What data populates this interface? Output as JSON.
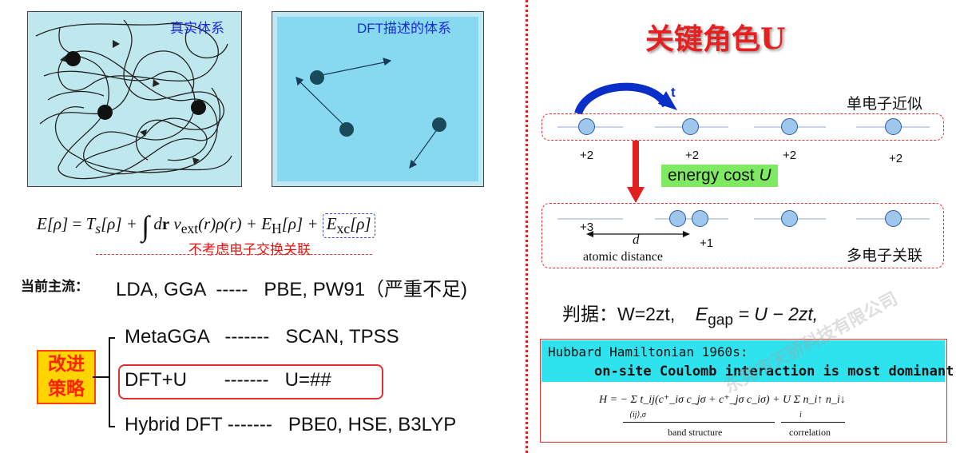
{
  "left": {
    "panel_real_label": "真实体系",
    "panel_dft_label": "DFT描述的体系",
    "formula": {
      "lhs": "E[ρ]",
      "eq": " = ",
      "ts": "T",
      "ts_sub": "s",
      "ts_arg": "[ρ] + ",
      "integral": "∫",
      "dr": " d",
      "dr_bold": "r",
      "v": " v",
      "v_sub": "ext",
      "v_arg": "(r)ρ(r) + ",
      "eh": "E",
      "eh_sub": "H",
      "eh_arg": "[ρ] + ",
      "exc": "E",
      "exc_sub": "xc",
      "exc_arg": "[ρ]"
    },
    "xc_note": "不考虑电子交换关联",
    "mainstream_label": "当前主流：",
    "mainstream_text": "LDA, GGA  -----   PBE, PW91（严重不足)",
    "strategy_label_1": "改进",
    "strategy_label_2": "策略",
    "strategies": [
      {
        "name": "MetaGGA",
        "dashes": "-------",
        "examples": "SCAN, TPSS"
      },
      {
        "name": "DFT+U",
        "dashes": "-------",
        "examples": "U=##"
      },
      {
        "name": "Hybrid DFT",
        "dashes": "-------",
        "examples": "PBE0, HSE, B3LYP"
      }
    ]
  },
  "right": {
    "title": "关键角色U",
    "hop_label": "t",
    "single_electron_label": "单电子近似",
    "top_charges": [
      "+2",
      "+2",
      "+2",
      "+2"
    ],
    "energy_cost": "energy cost ",
    "energy_cost_symbol": "U",
    "bottom_charges": [
      "+3",
      "+1"
    ],
    "distance_symbol": "d",
    "distance_label": "atomic distance",
    "many_electron_label": "多电子关联",
    "criterion_label": "判据：W=2zt,",
    "criterion_gap": "E",
    "criterion_gap_sub": "gap",
    "criterion_gap_rhs": " = U − 2zt,",
    "hubbard_title": "Hubbard Hamiltonian 1960s:",
    "hubbard_subtitle": "on-site Coulomb interaction is most dominant",
    "hubbard_eq": "H = − Σ t_ij(c⁺_iσ c_jσ + c⁺_jσ c_iσ) + U Σ n_i↑ n_i↓",
    "hubbard_sum_index_1": "⟨ij⟩,σ",
    "hubbard_sum_index_2": "i",
    "band_structure_label": "band structure",
    "correlation_label": "correlation",
    "watermark": "东莞市天骄科技有限公司"
  },
  "colors": {
    "panel_real_bg": "#bfe8ee",
    "panel_dft_bg": "#86d9ee",
    "accent_red": "#e23030",
    "label_blue": "#1c2bd6",
    "energy_green": "#7eea62",
    "hubbard_cyan": "#2ee2ee",
    "strategy_yellow": "#ffd400"
  },
  "icons": [
    "trajectory-scribble",
    "arrow-right",
    "hop-arrow-curve",
    "down-arrow-red"
  ]
}
